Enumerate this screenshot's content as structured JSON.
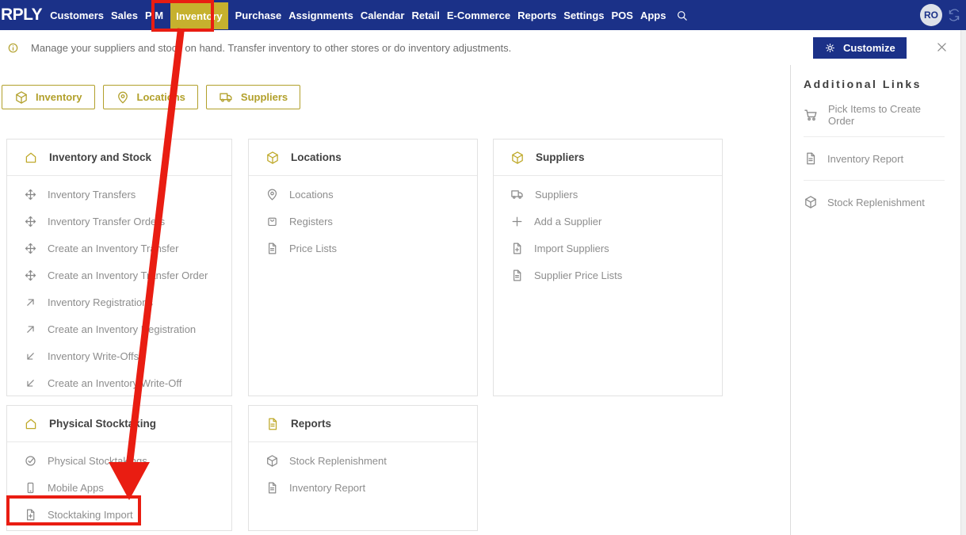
{
  "colors": {
    "nav_blue": "#1b3188",
    "active_yellow": "#c6b12e",
    "gold": "#b2a02b",
    "annotation_red": "#e91d12",
    "item_gray": "#8d8d8d"
  },
  "topnav": {
    "logo": "RPLY",
    "items": [
      "Customers",
      "Sales",
      "PIM",
      "Inventory",
      "Purchase",
      "Assignments",
      "Calendar",
      "Retail",
      "E-Commerce",
      "Reports",
      "Settings",
      "POS",
      "Apps"
    ],
    "active_item": "Inventory",
    "avatar_initials": "RO"
  },
  "infobar": {
    "message": "Manage your suppliers and stock on hand. Transfer inventory to other stores or do inventory adjustments.",
    "customize_label": "Customize"
  },
  "tabs": [
    {
      "label": "Inventory",
      "icon": "cube-icon"
    },
    {
      "label": "Locations",
      "icon": "map-pin-icon"
    },
    {
      "label": "Suppliers",
      "icon": "truck-icon"
    }
  ],
  "cards": [
    {
      "title": "Inventory and Stock",
      "title_icon": "home-icon",
      "items": [
        {
          "label": "Inventory Transfers",
          "icon": "move-icon"
        },
        {
          "label": "Inventory Transfer Orders",
          "icon": "move-icon"
        },
        {
          "label": "Create an Inventory Transfer",
          "icon": "move-icon"
        },
        {
          "label": "Create an Inventory Transfer Order",
          "icon": "move-icon"
        },
        {
          "label": "Inventory Registrations",
          "icon": "arrow-up-right-icon"
        },
        {
          "label": "Create an Inventory Registration",
          "icon": "arrow-up-right-icon"
        },
        {
          "label": "Inventory Write-Offs",
          "icon": "arrow-down-left-icon"
        },
        {
          "label": "Create an Inventory Write-Off",
          "icon": "arrow-down-left-icon"
        }
      ]
    },
    {
      "title": "Locations",
      "title_icon": "cube-icon",
      "items": [
        {
          "label": "Locations",
          "icon": "map-pin-icon"
        },
        {
          "label": "Registers",
          "icon": "register-icon"
        },
        {
          "label": "Price Lists",
          "icon": "file-icon"
        }
      ]
    },
    {
      "title": "Suppliers",
      "title_icon": "cube-icon",
      "items": [
        {
          "label": "Suppliers",
          "icon": "truck-icon"
        },
        {
          "label": "Add a Supplier",
          "icon": "plus-icon"
        },
        {
          "label": "Import Suppliers",
          "icon": "file-plus-icon"
        },
        {
          "label": "Supplier Price Lists",
          "icon": "file-icon"
        }
      ]
    },
    {
      "title": "Physical Stocktaking",
      "title_icon": "home-icon",
      "items": [
        {
          "label": "Physical Stocktakings",
          "icon": "check-circle-icon"
        },
        {
          "label": "Mobile Apps",
          "icon": "mobile-icon"
        },
        {
          "label": "Stocktaking Import",
          "icon": "file-plus-icon"
        }
      ]
    },
    {
      "title": "Reports",
      "title_icon": "file-icon",
      "items": [
        {
          "label": "Stock Replenishment",
          "icon": "cube-icon"
        },
        {
          "label": "Inventory Report",
          "icon": "file-icon"
        }
      ]
    }
  ],
  "sidebar": {
    "title": "Additional Links",
    "items": [
      {
        "label": "Pick Items to Create Order",
        "icon": "cart-icon"
      },
      {
        "label": "Inventory Report",
        "icon": "file-icon"
      },
      {
        "label": "Stock Replenishment",
        "icon": "cube-icon"
      }
    ]
  }
}
